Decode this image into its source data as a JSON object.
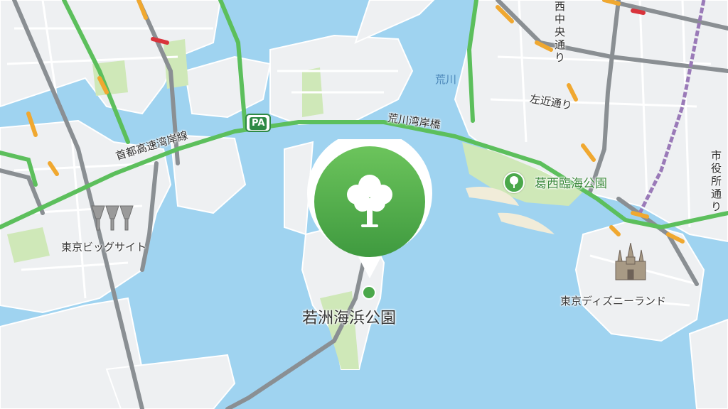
{
  "map": {
    "colors": {
      "water": "#9fd3f0",
      "land": "#eef0f2",
      "park": "#cfe8b8",
      "road_gray": "#8a8f93",
      "traffic_green": "#5cbf5c",
      "traffic_orange": "#f0a830",
      "traffic_red": "#d9343c",
      "pin_green": "#4aa84a"
    },
    "selected_place": {
      "name": "若洲海浜公園",
      "icon": "tree-icon"
    },
    "labels": {
      "expressway_bayshore": "首都高速湾岸線",
      "arakawa_bridge": "荒川湾岸橋",
      "arakawa_river": "荒川",
      "sakon_dori": "左近通り",
      "nishi_chuo_dori": "西中央通り",
      "shiyakusho_dori": "市役所通り",
      "kasai_park": "葛西臨海公園",
      "big_sight": "東京ビッグサイト",
      "disneyland": "東京ディズニーランド",
      "parking_area_badge": "PA"
    },
    "poi_icons": {
      "big_sight": "big-sight-building-icon",
      "disneyland": "castle-icon",
      "kasai_park": "tree-icon"
    }
  }
}
